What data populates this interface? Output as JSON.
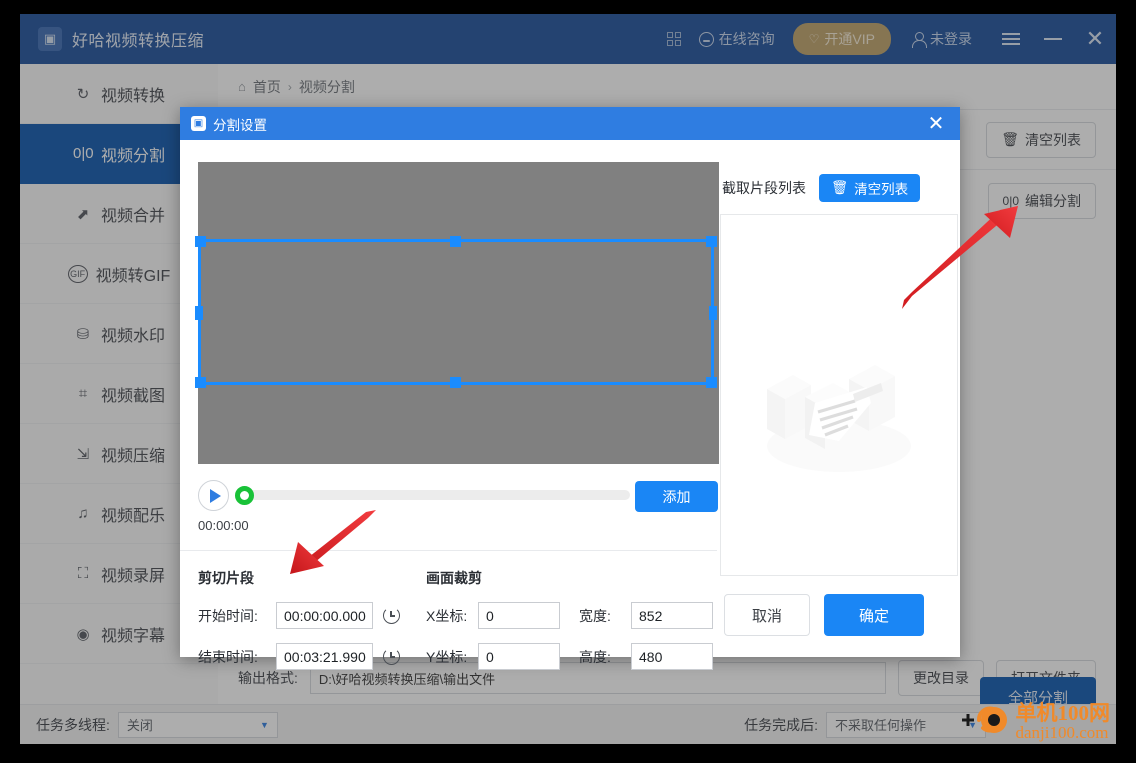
{
  "titlebar": {
    "app_title": "好哈视频转换压缩",
    "logo_icon": "app-logo-icon",
    "grid_icon": "qr-grid-icon",
    "consult_label": "在线咨询",
    "vip_label": "开通VIP",
    "login_label": "未登录",
    "menu_icon": "hamburger-icon",
    "minimize_icon": "minimize-icon",
    "close_icon": "close-icon",
    "bg_color": "#1b4f9c",
    "vip_color": "#bfa268"
  },
  "sidebar": {
    "items": [
      {
        "label": "视频转换",
        "icon": "convert-icon",
        "glyph": "↻",
        "active": false
      },
      {
        "label": "视频分割",
        "icon": "split-icon",
        "glyph": "0|0",
        "active": true
      },
      {
        "label": "视频合并",
        "icon": "merge-icon",
        "glyph": "⇱",
        "active": false
      },
      {
        "label": "视频转GIF",
        "icon": "gif-icon",
        "glyph": "GIF",
        "active": false
      },
      {
        "label": "视频水印",
        "icon": "watermark-icon",
        "glyph": "⌾",
        "active": false
      },
      {
        "label": "视频截图",
        "icon": "screenshot-icon",
        "glyph": "⊿",
        "active": false
      },
      {
        "label": "视频压缩",
        "icon": "compress-icon",
        "glyph": "[↹]",
        "active": false
      },
      {
        "label": "视频配乐",
        "icon": "music-icon",
        "glyph": "♫",
        "active": false
      },
      {
        "label": "视频录屏",
        "icon": "record-icon",
        "glyph": "⛶",
        "active": false
      },
      {
        "label": "视频字幕",
        "icon": "subtitle-icon",
        "glyph": "◎",
        "active": false
      }
    ],
    "active_color": "#0a56ae"
  },
  "main": {
    "breadcrumb": {
      "home_icon": "home-icon",
      "home": "首页",
      "separator": "›",
      "current": "视频分割"
    },
    "clear_list_label": "清空列表",
    "clear_list_icon": "trash-icon",
    "edit_split_label": "编辑分割",
    "edit_split_icon": "split-icon",
    "output_label": "输出格式:",
    "output_path": "D:\\好哈视频转换压缩\\输出文件",
    "change_dir_label": "更改目录",
    "open_folder_label": "打开文件夹",
    "split_all_label": "全部分割"
  },
  "footer": {
    "multithread_label": "任务多线程:",
    "multithread_value": "关闭",
    "aftertask_label": "任务完成后:",
    "aftertask_value": "不采取任何操作",
    "caret_icon": "chevron-down-icon"
  },
  "modal": {
    "title": "分割设置",
    "logo_icon": "app-logo-icon",
    "close_icon": "close-icon",
    "header_color": "#2f7de1",
    "preview": {
      "crop_overlay_color": "#1a8cff",
      "handles": [
        "top-left",
        "top-center",
        "top-right",
        "middle-left",
        "middle-right",
        "bottom-left",
        "bottom-center",
        "bottom-right"
      ]
    },
    "player": {
      "play_icon": "play-icon",
      "knob_icon": "slider-knob",
      "knob_color": "#19c238",
      "current_time": "00:00:00",
      "add_label": "添加"
    },
    "clip_section": {
      "title": "剪切片段",
      "start_label": "开始时间:",
      "start_value": "00:00:00.000",
      "end_label": "结束时间:",
      "end_value": "00:03:21.990",
      "clock_icon": "clock-reset-icon"
    },
    "crop_section": {
      "title": "画面裁剪",
      "x_label": "X坐标:",
      "x_value": "0",
      "y_label": "Y坐标:",
      "y_value": "0",
      "w_label": "宽度:",
      "w_value": "852",
      "h_label": "高度:",
      "h_value": "480"
    },
    "right_panel": {
      "title": "截取片段列表",
      "clear_label": "清空列表",
      "clear_icon": "trash-icon",
      "empty_illustration": "empty-box-icon",
      "cancel_label": "取消",
      "ok_label": "确定"
    }
  },
  "annotations": {
    "arrow_color": "#e8272b",
    "arrows": [
      "arrow-to-edit-split-button",
      "arrow-to-start-time-input"
    ]
  },
  "watermark": {
    "line1": "单机100网",
    "line2": "danji100.com",
    "color": "#f08a2a"
  }
}
